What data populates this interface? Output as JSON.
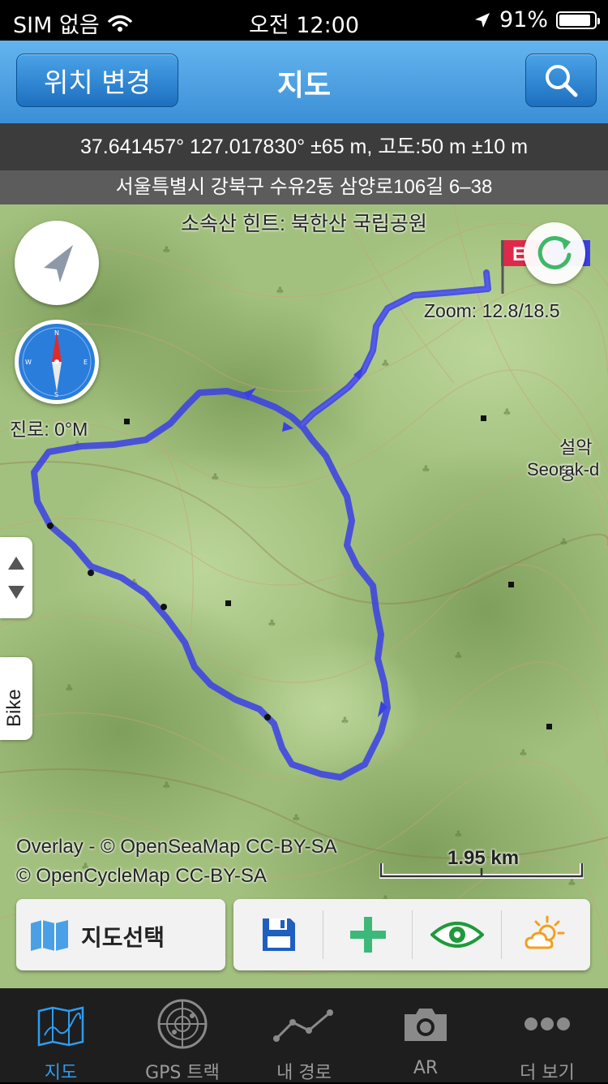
{
  "status_bar": {
    "carrier": "SIM 없음",
    "time": "오전 12:00",
    "battery": "91%",
    "battery_level": 0.91
  },
  "nav": {
    "left_button": "위치 변경",
    "title": "지도"
  },
  "info": {
    "coordinates": "37.641457° 127.017830° ±65 m, 고도:50 m ±10 m",
    "address": "서울특별시 강북구 수유2동 삼양로106길 6–38"
  },
  "map": {
    "hint": "소속산 힌트: 북한산 국립공원",
    "zoom": "Zoom: 12.8/18.5",
    "heading": "진로: 0°M",
    "place_label_ko": "설악동",
    "place_label_en": "Seorak-d",
    "side_tab_label": "Bike",
    "attribution_line1": "Overlay - © OpenSeaMap CC-BY-SA",
    "attribution_line2": "© OpenCycleMap CC-BY-SA",
    "scale_label": "1.95 km",
    "flag_letter": "E",
    "colors": {
      "track": "#3a3fe6",
      "terrain": "#9cbb77",
      "accent": "#2e9cf2"
    }
  },
  "bottom_panel": {
    "map_select_label": "지도선택"
  },
  "tabs": [
    {
      "label": "지도",
      "icon": "map-icon",
      "active": true
    },
    {
      "label": "GPS 트랙",
      "icon": "radar-icon",
      "active": false
    },
    {
      "label": "내 경로",
      "icon": "route-icon",
      "active": false
    },
    {
      "label": "AR",
      "icon": "camera-icon",
      "active": false
    },
    {
      "label": "더 보기",
      "icon": "more-icon",
      "active": false
    }
  ]
}
